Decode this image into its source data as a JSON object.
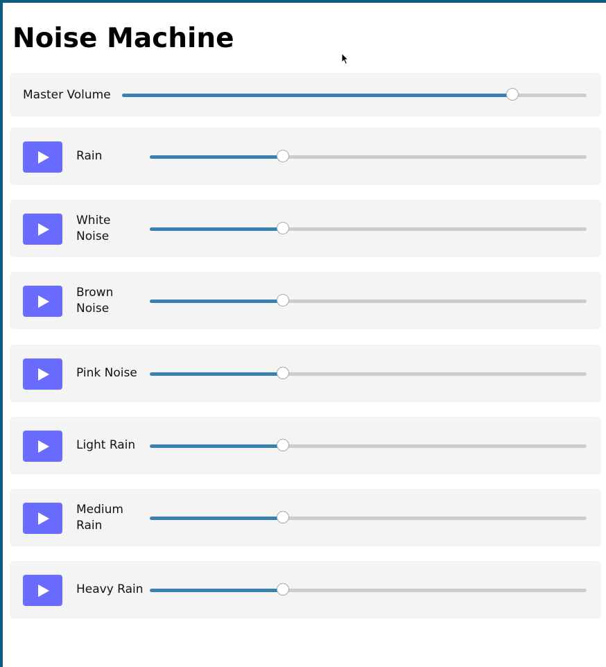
{
  "app": {
    "title": "Noise Machine"
  },
  "master": {
    "label": "Master Volume",
    "value": 0.84
  },
  "channels": [
    {
      "label": "Rain",
      "volume": 0.305,
      "playing": false
    },
    {
      "label": "White Noise",
      "volume": 0.305,
      "playing": false
    },
    {
      "label": "Brown Noise",
      "volume": 0.305,
      "playing": false
    },
    {
      "label": "Pink Noise",
      "volume": 0.305,
      "playing": false
    },
    {
      "label": "Light Rain",
      "volume": 0.305,
      "playing": false
    },
    {
      "label": "Medium Rain",
      "volume": 0.305,
      "playing": false
    },
    {
      "label": "Heavy Rain",
      "volume": 0.305,
      "playing": false
    }
  ],
  "icons": {
    "play": "play-icon",
    "cursor": "mouse-pointer-icon"
  },
  "colors": {
    "accent_button": "#6a6cff",
    "slider_fill": "#3a80b2",
    "slider_track": "#cccccc",
    "panel_background": "#f4f4f4",
    "frame_border": "#0f5a7e"
  }
}
